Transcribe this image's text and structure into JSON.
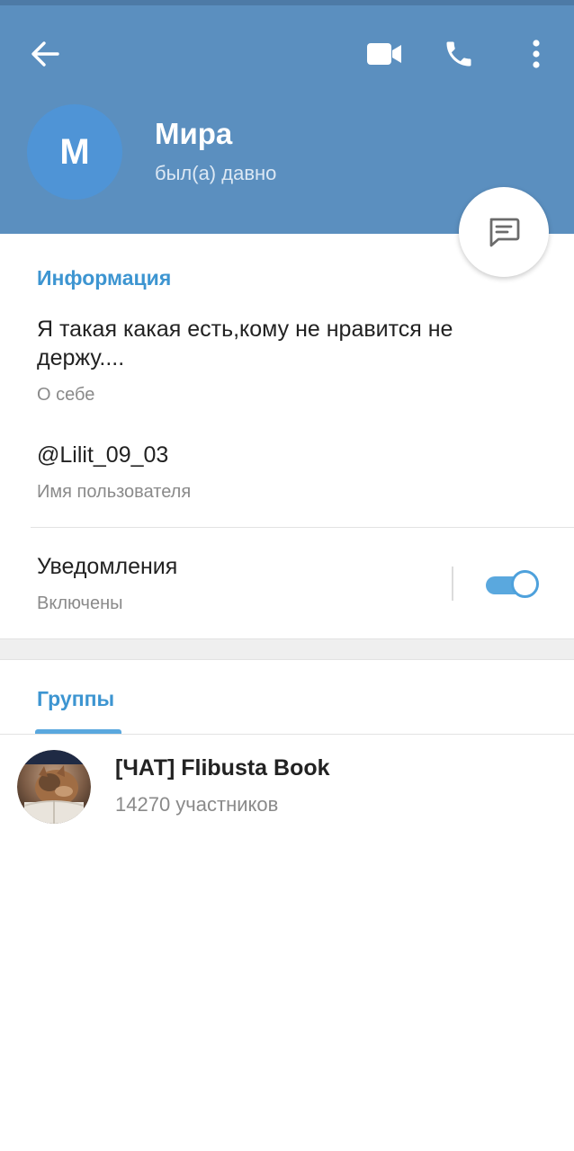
{
  "header": {
    "name": "Мира",
    "status": "был(а) давно",
    "avatar_initial": "M",
    "colors": {
      "header_bg": "#5b8fbf",
      "avatar_bg": "#4f94d6",
      "accent": "#3d95d1"
    },
    "icons": [
      "arrow-back-icon",
      "video-call-icon",
      "phone-icon",
      "more-vertical-icon",
      "chat-icon"
    ]
  },
  "info": {
    "section_title": "Информация",
    "bio": "Я такая какая есть,кому не нравится не держу....",
    "bio_label": "О себе",
    "username": "@Lilit_09_03",
    "username_label": "Имя пользователя"
  },
  "notifications": {
    "title": "Уведомления",
    "status": "Включены",
    "enabled": true
  },
  "groups": {
    "tab_title": "Группы",
    "items": [
      {
        "name": "[ЧАТ] Flibusta Book",
        "members": "14270 участников"
      }
    ]
  }
}
